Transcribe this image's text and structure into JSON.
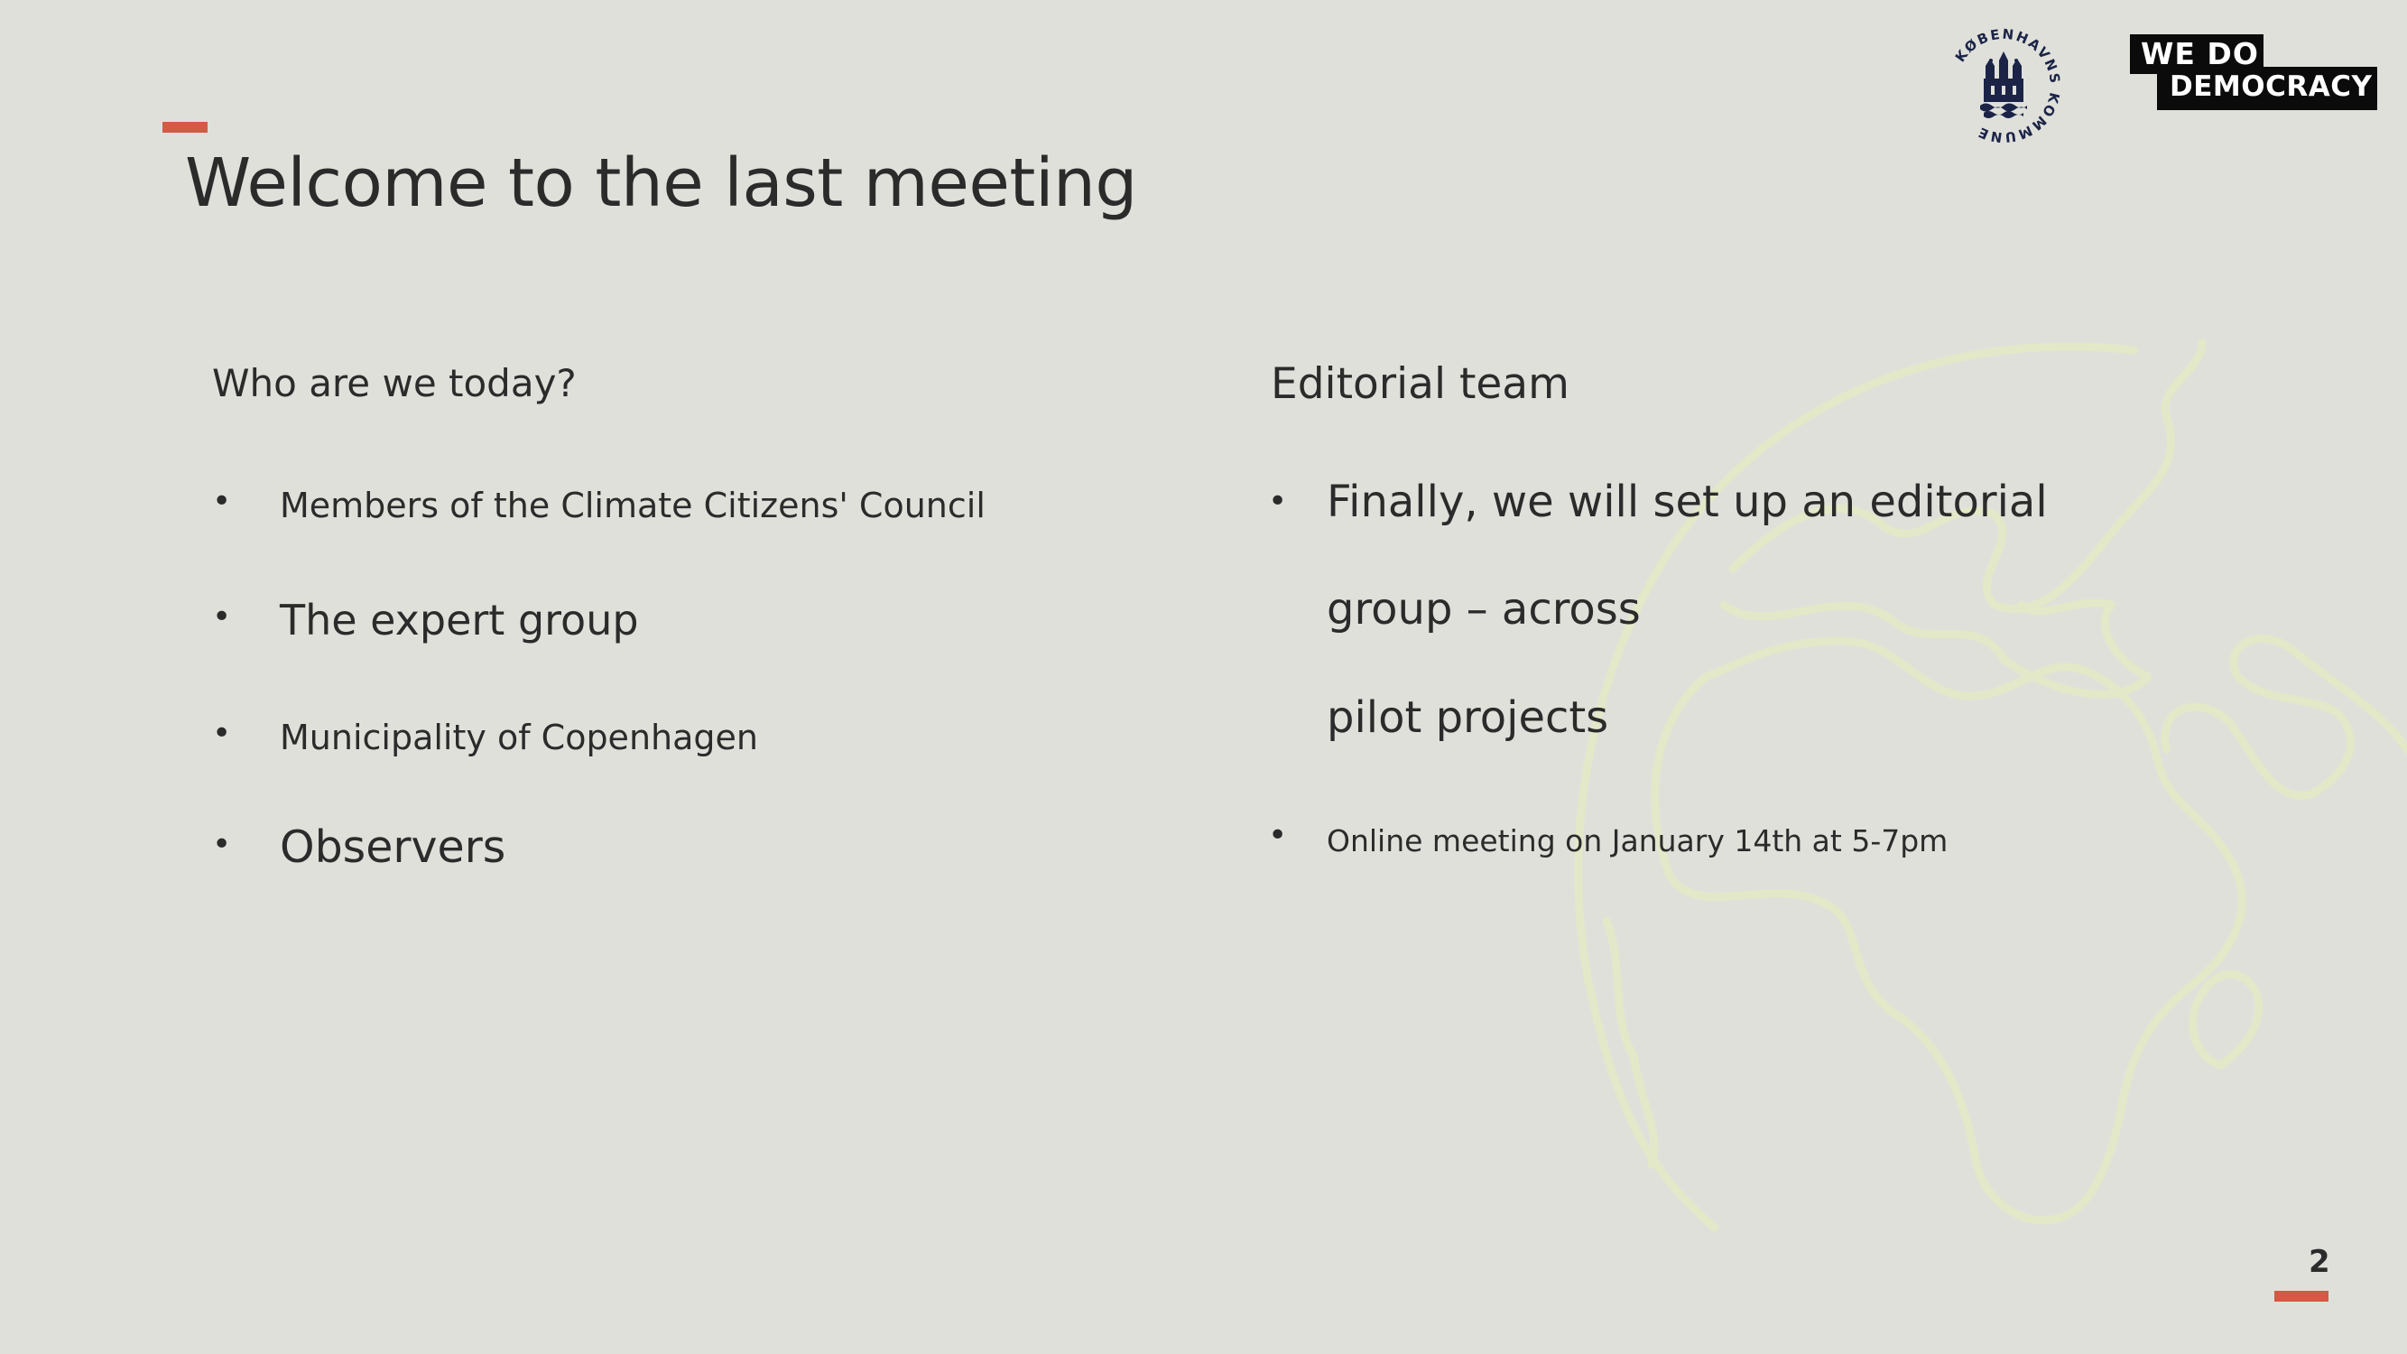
{
  "slide": {
    "title": "Welcome to the last meeting",
    "page_number": "2",
    "accent_color": "#d45a45",
    "background_color": "#e0e0db"
  },
  "left_column": {
    "heading": "Who are we today?",
    "items": [
      "Members of the Climate Citizens' Council",
      "The expert group",
      "Municipality of Copenhagen",
      "Observers"
    ]
  },
  "right_column": {
    "heading": "Editorial team",
    "items": [
      [
        "Finally, we will set up an editorial",
        "group – across",
        "pilot projects"
      ],
      "Online meeting on January 14th at 5-7pm"
    ]
  },
  "logos": {
    "kobenhavns_kommune": {
      "text": "KØBENHAVNS KOMMUNE",
      "icon": "city-seal-icon"
    },
    "we_do_democracy": {
      "line1": "WE  DO",
      "line2": "DEMOCRACY"
    }
  },
  "decoration": {
    "icon": "globe-outline-icon",
    "color": "#e2e8c6"
  }
}
